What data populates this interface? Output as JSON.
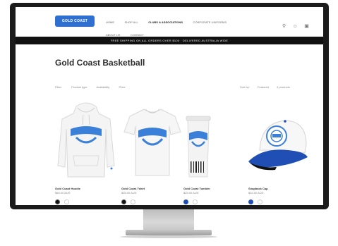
{
  "header": {
    "logo_text": "GOLD COAST",
    "nav": [
      "Home",
      "Shop All",
      "Clubs & Associations",
      "Corporate Uniforms",
      "About Us",
      "Contact"
    ],
    "active_nav_index": 2,
    "icons": [
      "search-icon",
      "account-icon",
      "cart-icon"
    ]
  },
  "announcement": "FREE SHIPPING ON ALL ORDERS OVER $100 · DELIVERED AUSTRALIA WIDE",
  "collection": {
    "title": "Gold Coast Basketball",
    "filters": [
      "Filter:",
      "Product type",
      "Availability",
      "Price"
    ],
    "sort": [
      "Sort by:",
      "Featured",
      "4 products"
    ]
  },
  "products": [
    {
      "title": "Gold Coast Hoodie",
      "price": "$65.00 AUD",
      "type": "hoodie",
      "swatches": [
        "#111111",
        "#ffffff"
      ],
      "selected_swatch": 0
    },
    {
      "title": "Gold Coast Tshirt",
      "price": "$35.00 AUD",
      "type": "tshirt",
      "swatches": [
        "#111111",
        "#ffffff"
      ],
      "selected_swatch": 0
    },
    {
      "title": "Gold Coast Tumbler",
      "price": "$29.00 AUD",
      "type": "tumbler",
      "swatches": [
        "#1f4fb5",
        "#ffffff"
      ],
      "selected_swatch": 0
    },
    {
      "title": "Snapback Cap",
      "price": "$32.00 AUD",
      "type": "cap",
      "swatches": [
        "#1f4fb5",
        "#ffffff"
      ],
      "selected_swatch": 0
    }
  ],
  "colors": {
    "brand_blue": "#2f6fd0",
    "print_blue": "#3a7fd8",
    "announcement_bg": "#111111",
    "cap_brim": "#1f4fb5"
  }
}
